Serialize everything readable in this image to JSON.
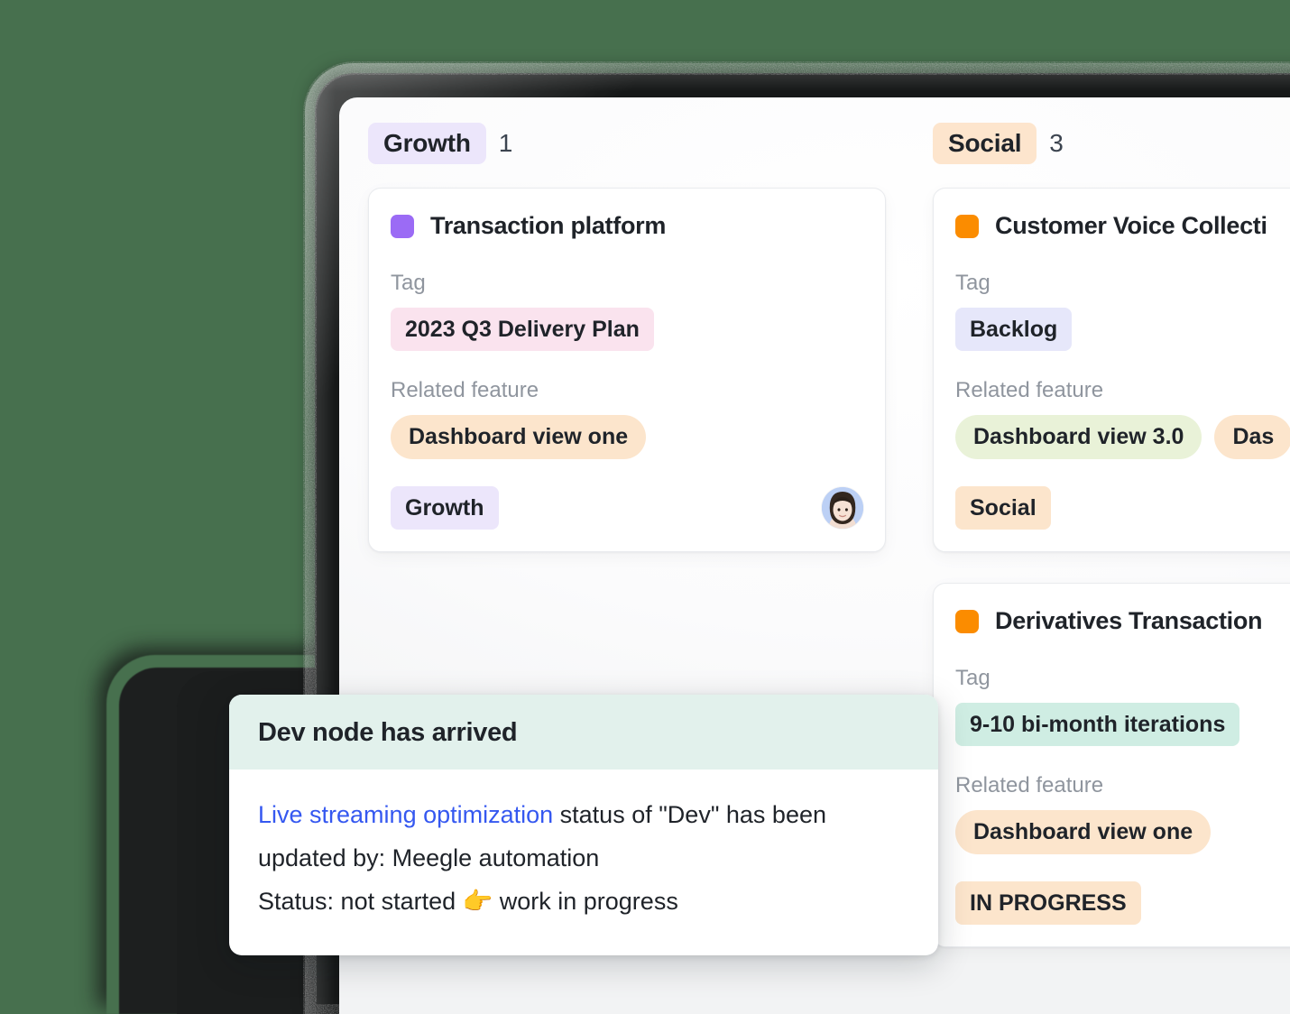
{
  "theme": {
    "page_background": "#47704E",
    "screen_background": "#FBFBFC",
    "bezel": "#161818"
  },
  "board": {
    "columns": [
      {
        "name": "growth-column",
        "label": "Growth",
        "count": "1",
        "pill_color": "#ECE6FB",
        "cards": [
          {
            "swatch_color": "#9B6BF5",
            "title": "Transaction platform",
            "tag_label": "Tag",
            "tags": [
              {
                "text": "2023 Q3 Delivery Plan",
                "color": "#FAE3EE"
              }
            ],
            "related_label": "Related feature",
            "related": [
              {
                "text": "Dashboard view one",
                "color": "#FCE5CC"
              }
            ],
            "footer_chips": [
              {
                "text": "Growth",
                "color": "#ECE6FB"
              }
            ],
            "has_avatar": true,
            "avatar_name": "assignee-avatar"
          }
        ]
      },
      {
        "name": "social-column",
        "label": "Social",
        "count": "3",
        "pill_color": "#FDE5CD",
        "cards": [
          {
            "swatch_color": "#FB8C00",
            "title": "Customer Voice Collecti",
            "tag_label": "Tag",
            "tags": [
              {
                "text": "Backlog",
                "color": "#E6E7FA"
              }
            ],
            "related_label": "Related feature",
            "related": [
              {
                "text": "Dashboard view 3.0",
                "color": "#E9F2D8"
              },
              {
                "text": "Das",
                "color": "#FCE5CC"
              }
            ],
            "footer_chips": [
              {
                "text": "Social",
                "color": "#FCE5CC"
              }
            ],
            "has_avatar": false
          },
          {
            "swatch_color": "#FB8C00",
            "title": "Derivatives Transaction",
            "tag_label": "Tag",
            "tags": [
              {
                "text": "9-10 bi-month iterations",
                "color": "#CFEDE3"
              }
            ],
            "related_label": "Related feature",
            "related": [
              {
                "text": "Dashboard view one",
                "color": "#FCE5CC"
              }
            ],
            "footer_chips": [
              {
                "text": "IN PROGRESS",
                "color": "#FCE5CC"
              }
            ],
            "has_avatar": false
          }
        ]
      }
    ]
  },
  "toast": {
    "title": "Dev node has arrived",
    "link_text": "Live streaming optimization",
    "line1_rest": "  status of \"Dev\" has been",
    "line2": "updated by: Meegle automation",
    "line3": "Status: not started 👉 work in progress",
    "header_color": "#E2F1EC",
    "link_color": "#3558F0"
  }
}
